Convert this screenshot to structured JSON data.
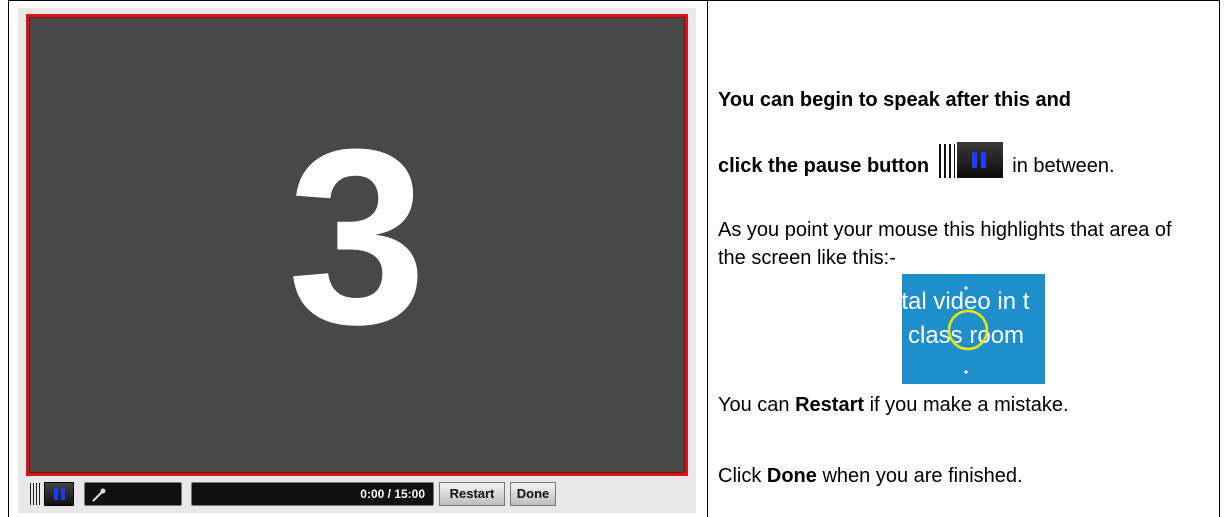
{
  "recorder": {
    "countdown": "3",
    "timer": "0:00 / 15:00",
    "restart_label": "Restart",
    "done_label": "Done",
    "icons": [
      "grip-icon",
      "pause-icon",
      "microphone-icon"
    ],
    "colors": {
      "stage": "#484848",
      "border": "#d8141a",
      "pause_bars": "#1a3cff"
    }
  },
  "instructions": {
    "line1": "You can begin to speak after this and",
    "line2_bold": "click the pause button",
    "line2_rest": "in between.",
    "line3": "As you point your mouse this highlights that area of the screen like this:-",
    "demo_text_1": "ital video in t",
    "demo_text_2": "class room",
    "line4_pre": "You can ",
    "line4_bold": "Restart",
    "line4_post": " if you make a mistake.",
    "line5_pre": "Click ",
    "line5_bold": "Done",
    "line5_post": " when you are finished."
  }
}
